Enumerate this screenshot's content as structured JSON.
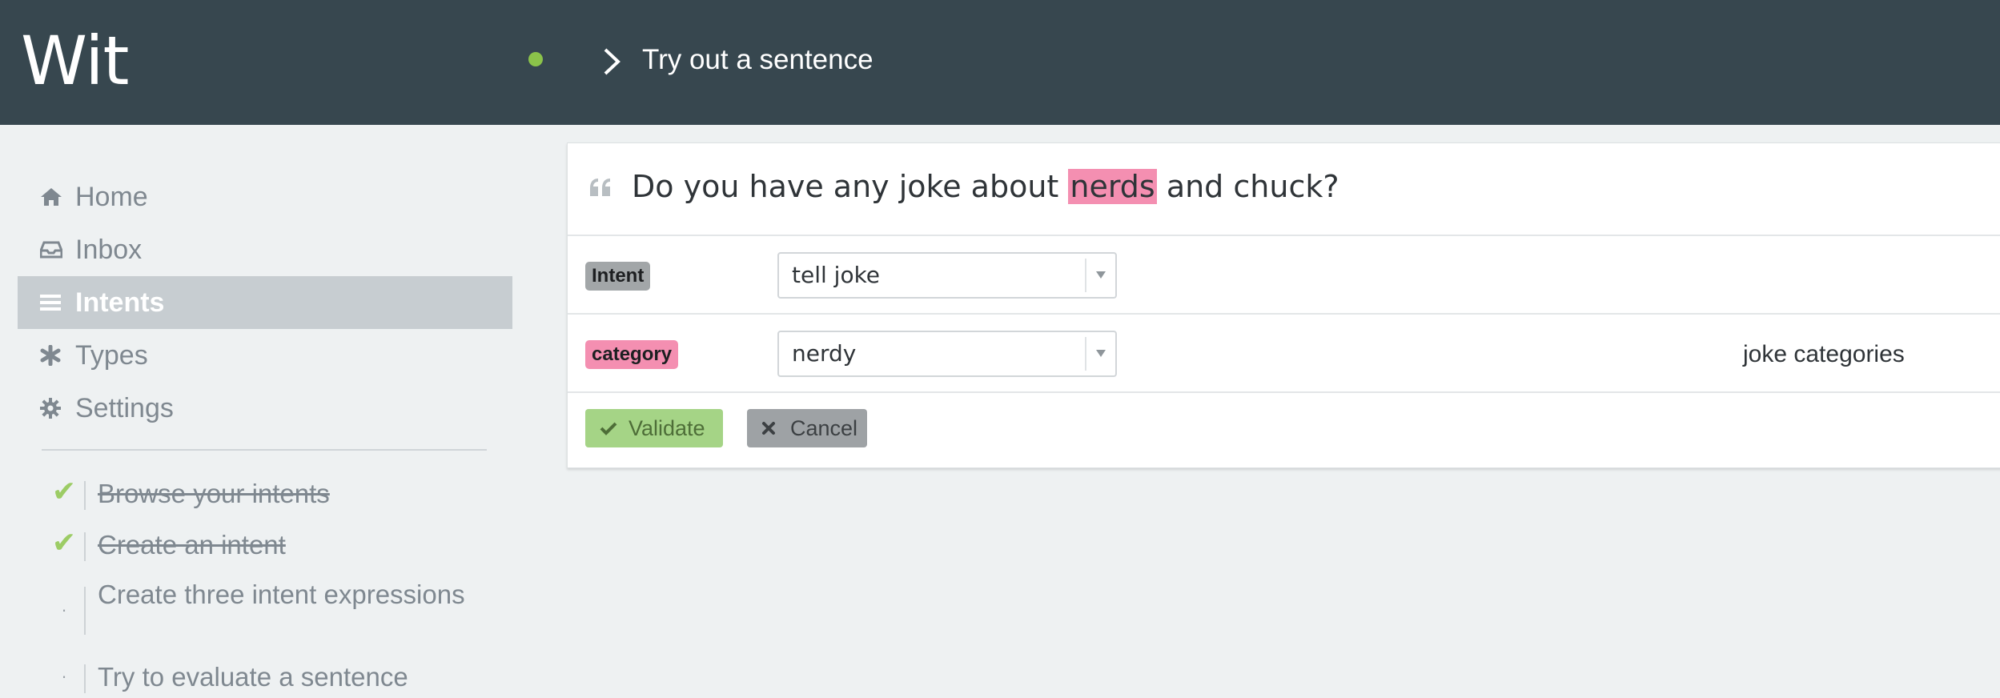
{
  "header": {
    "logo": "Wit",
    "breadcrumb_title": "Try out a sentence",
    "status_color": "#8bc34a"
  },
  "sidebar": {
    "items": [
      {
        "label": "Home",
        "icon": "home-icon"
      },
      {
        "label": "Inbox",
        "icon": "inbox-icon"
      },
      {
        "label": "Intents",
        "icon": "list-icon",
        "active": true
      },
      {
        "label": "Types",
        "icon": "asterisk-icon"
      },
      {
        "label": "Settings",
        "icon": "gear-icon"
      }
    ],
    "checklist": [
      {
        "text": "Browse your intents",
        "done": true
      },
      {
        "text": "Create an intent",
        "done": true
      },
      {
        "text": "Create three intent expressions",
        "done": false
      },
      {
        "text": "Try to evaluate a sentence",
        "done": false
      }
    ]
  },
  "sentence": {
    "before": "Do you have any joke about ",
    "highlight": "nerds",
    "after": " and chuck?"
  },
  "rows": [
    {
      "tag": "Intent",
      "value": "tell joke",
      "type": ""
    },
    {
      "tag": "category",
      "value": "nerdy",
      "type": "joke categories"
    }
  ],
  "buttons": {
    "validate": "Validate",
    "cancel": "Cancel"
  },
  "colors": {
    "header_bg": "#37474f",
    "highlight": "#f48fb1",
    "validate": "#a5d486",
    "cancel": "#9ea2a5"
  }
}
